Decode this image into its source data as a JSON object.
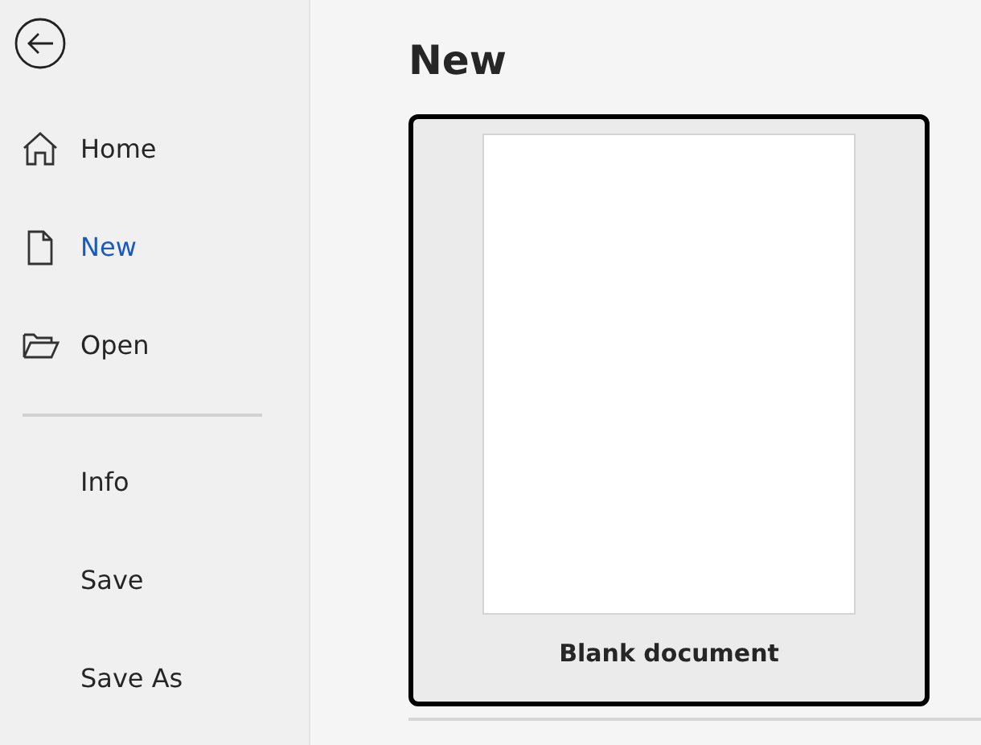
{
  "sidebar": {
    "nav_primary": [
      {
        "kind": "home",
        "label": "Home",
        "selected": false
      },
      {
        "kind": "document",
        "label": "New",
        "selected": true
      },
      {
        "kind": "folder",
        "label": "Open",
        "selected": false
      }
    ],
    "nav_secondary": [
      {
        "label": "Info",
        "selected": false
      },
      {
        "label": "Save",
        "selected": false
      },
      {
        "label": "Save As",
        "selected": false
      }
    ]
  },
  "main": {
    "title": "New",
    "templates": [
      {
        "label": "Blank document",
        "selected": true
      }
    ]
  }
}
